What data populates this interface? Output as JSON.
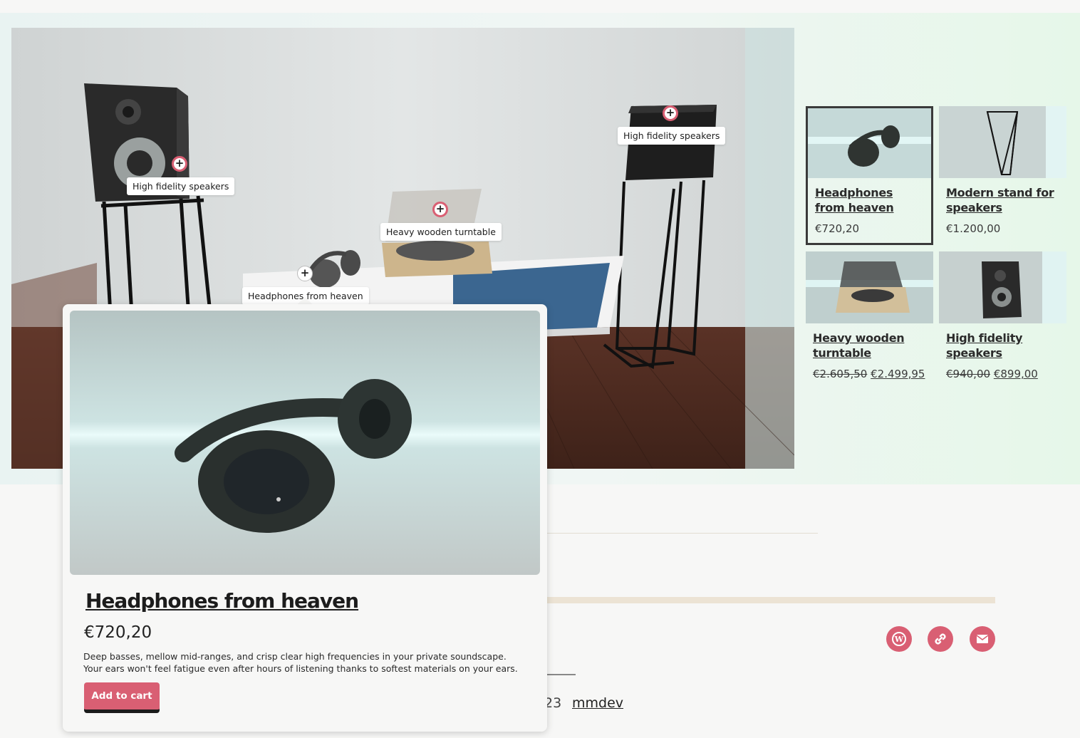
{
  "scene": {
    "hotspots": [
      {
        "label": "High fidelity speakers"
      },
      {
        "label": "High fidelity speakers"
      },
      {
        "label": "Heavy wooden turntable"
      },
      {
        "label": "Headphones from heaven"
      }
    ]
  },
  "products": [
    {
      "title": "Headphones from heaven",
      "price": "€720,20",
      "old_price": "",
      "selected": true
    },
    {
      "title": "Modern stand for speakers",
      "price": "€1.200,00",
      "old_price": ""
    },
    {
      "title": "Heavy wooden turntable",
      "price": "€2.499,95",
      "old_price": "€2.605,50"
    },
    {
      "title": "High fidelity speakers",
      "price": "€899,00",
      "old_price": "€940,00"
    }
  ],
  "popup": {
    "title": "Headphones from heaven",
    "price": "€720,20",
    "description": "Deep basses, mellow mid-ranges, and crisp clear high frequencies in your private soundscape. Your ears won't feel fatigue even after hours of listening thanks to softest materials on your ears.",
    "add_to_cart": "Add to cart"
  },
  "footer": {
    "fragment": "23",
    "credit_link": "mmdev",
    "social": [
      "wordpress-icon",
      "link-icon",
      "mail-icon"
    ]
  },
  "colors": {
    "accent": "#d95f73",
    "background": "#f7f7f6"
  }
}
